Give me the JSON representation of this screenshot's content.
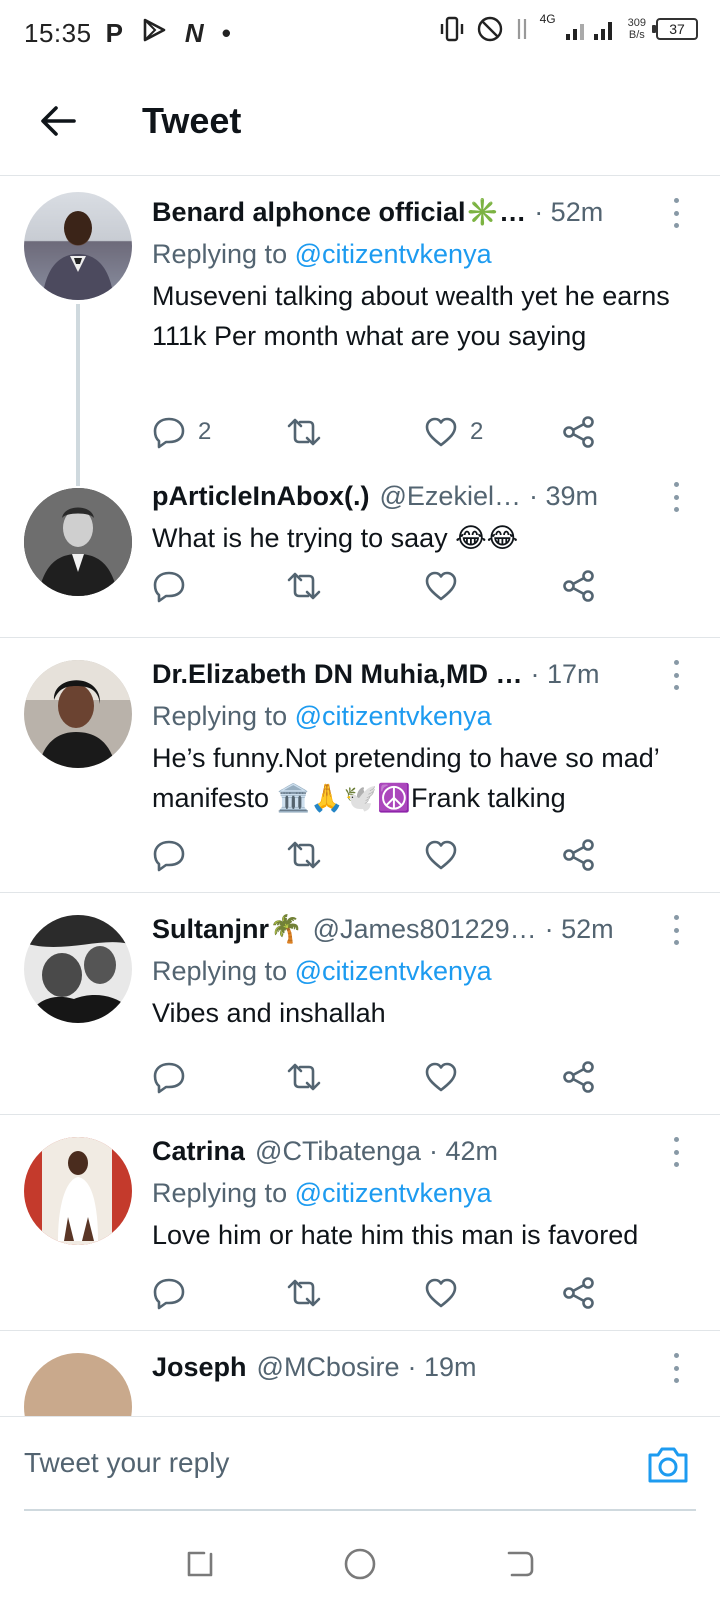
{
  "status_bar": {
    "time": "15:35",
    "left_icons": [
      "P",
      "play-icon",
      "N",
      "•"
    ],
    "network": "4G",
    "speed_value": "309",
    "speed_unit": "B/s",
    "battery": "37"
  },
  "header": {
    "title": "Tweet"
  },
  "colors": {
    "accent": "#1d9bf0",
    "muted": "#536471",
    "text": "#0f1419",
    "divider": "#e1e5e8"
  },
  "tweets": [
    {
      "name": "Benard alphonce official✳️…",
      "handle": "",
      "time": "· 52m",
      "replying_prefix": "Replying to ",
      "replying_to": "@citizentvkenya",
      "text": "Museveni talking about wealth yet he earns 111k Per month what are you saying",
      "reply_count": "2",
      "retweet_count": "",
      "like_count": "2"
    },
    {
      "name": "pArticleInAbox(.)",
      "handle": "@Ezekiel…",
      "time": "· 39m",
      "text": "What is he trying to saay 😂😂",
      "reply_count": "",
      "retweet_count": "",
      "like_count": ""
    },
    {
      "name": "Dr.Elizabeth DN Muhia,MD …",
      "handle": "",
      "time": "· 17m",
      "replying_prefix": "Replying to ",
      "replying_to": "@citizentvkenya",
      "text": "He’s funny.Not pretending to have so mad’ manifesto 🏛️🙏🕊️☮️Frank talking",
      "reply_count": "",
      "retweet_count": "",
      "like_count": ""
    },
    {
      "name": "Sultanjnr🌴",
      "handle": "@James801229…",
      "time": "· 52m",
      "replying_prefix": "Replying to ",
      "replying_to": "@citizentvkenya",
      "text": "Vibes and inshallah",
      "reply_count": "",
      "retweet_count": "",
      "like_count": ""
    },
    {
      "name": "Catrina",
      "handle": "@CTibatenga",
      "time": "· 42m",
      "replying_prefix": "Replying to ",
      "replying_to": "@citizentvkenya",
      "text": "Love him or hate him this man is favored",
      "reply_count": "",
      "retweet_count": "",
      "like_count": ""
    },
    {
      "name": "Joseph",
      "handle": "@MCbosire",
      "time": "· 19m"
    }
  ],
  "composer": {
    "placeholder": "Tweet your reply"
  }
}
